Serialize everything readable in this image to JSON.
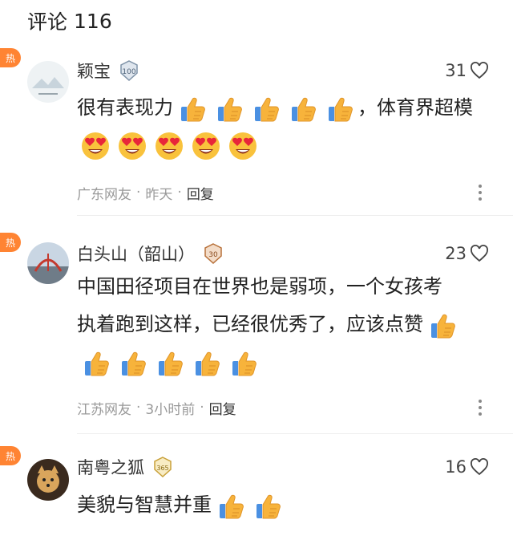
{
  "header": {
    "title": "评论",
    "count": "116"
  },
  "hot_label": "热",
  "comments": [
    {
      "name": "颖宝",
      "badge": "100",
      "likes": "31",
      "text_lines": [
        "很有表现力",
        "，体育界超模"
      ],
      "location": "广东网友",
      "time": "昨天",
      "reply": "回复"
    },
    {
      "name": "白头山（韶山）",
      "badge": "30",
      "likes": "23",
      "text_line1": "中国田径项目在世界也是弱项，一个女孩考",
      "text_line2": "执着跑到这样，已经很优秀了，应该点赞",
      "location": "江苏网友",
      "time": "3小时前",
      "reply": "回复"
    },
    {
      "name": "南粤之狐",
      "badge": "365",
      "likes": "16",
      "text": "美貌与智慧并重"
    }
  ],
  "icons": {
    "heart": "heart-outline-icon",
    "thumb": "thumbs-up-emoji",
    "hearteyes": "heart-eyes-emoji",
    "more": "more-vertical-icon"
  },
  "colors": {
    "hot_badge": "#ff8433",
    "meta_text": "#999999"
  }
}
